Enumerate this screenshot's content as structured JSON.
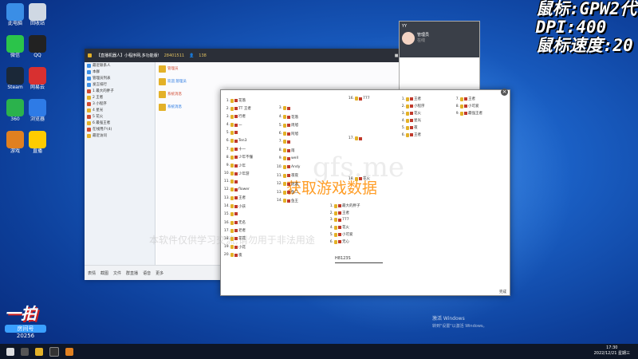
{
  "overlay": {
    "line1": "鼠标:GPW2代",
    "line2": "DPI:400",
    "line3": "鼠标速度:20"
  },
  "desktop_icons": [
    {
      "label": "此电脑",
      "color": "#3a8ee6"
    },
    {
      "label": "回收站",
      "color": "#cfd8e3"
    },
    {
      "label": "微信",
      "color": "#2bc44a"
    },
    {
      "label": "QQ",
      "color": "#222"
    },
    {
      "label": "Steam",
      "color": "#1b2838"
    },
    {
      "label": "网易云",
      "color": "#d83030"
    },
    {
      "label": "360",
      "color": "#2bb24c"
    },
    {
      "label": "浏览器",
      "color": "#2e7be6"
    },
    {
      "label": "游戏",
      "color": "#e08020"
    },
    {
      "label": "直播",
      "color": "#ffcc00"
    }
  ],
  "chat": {
    "title": "【直播机器人】小程序网,多功能版!",
    "id_text": "28401511",
    "count": "138",
    "side_rows": [
      "最近联系人",
      "本群",
      "管理员列表",
      "发言排行",
      "1 最大的胖子",
      "2 王者",
      "3 小程序",
      "4 星光",
      "5 花火",
      "6 最强王者",
      "在线用户(4)",
      "最近访问"
    ],
    "msgs": [
      "管理员",
      "欢迎,管理员",
      "系统消息",
      "系统消息"
    ],
    "foot": [
      "表情",
      "截图",
      "文件",
      "群直播",
      "语音",
      "更多"
    ]
  },
  "popup": {
    "title": "YY",
    "name": "管理员",
    "sub": "在线"
  },
  "tool": {
    "left_list": [
      {
        "n": "1.",
        "t": "花落"
      },
      {
        "n": "2.",
        "t": "TT 王者"
      },
      {
        "n": "3.",
        "t": "行者"
      },
      {
        "n": "4.",
        "t": "一"
      },
      {
        "n": "5.",
        "t": ""
      },
      {
        "n": "6.",
        "t": "Ten3"
      },
      {
        "n": "7.",
        "t": "十一"
      },
      {
        "n": "8.",
        "t": "少年不懂"
      },
      {
        "n": "9.",
        "t": "少年"
      },
      {
        "n": "10.",
        "t": "少年游"
      },
      {
        "n": "11.",
        "t": ""
      },
      {
        "n": "12.",
        "t": "flower"
      },
      {
        "n": "13.",
        "t": "王者"
      },
      {
        "n": "14.",
        "t": "小孩"
      },
      {
        "n": "15.",
        "t": ""
      },
      {
        "n": "16.",
        "t": "无名"
      },
      {
        "n": "17.",
        "t": "老者"
      },
      {
        "n": "18.",
        "t": "花花"
      },
      {
        "n": "19.",
        "t": "小花"
      },
      {
        "n": "20.",
        "t": "夜"
      }
    ],
    "mid_list": [
      {
        "n": "3.",
        "t": ""
      },
      {
        "n": "4.",
        "t": "花落"
      },
      {
        "n": "5.",
        "t": "周旭"
      },
      {
        "n": "6.",
        "t": "阿旭"
      },
      {
        "n": "7.",
        "t": ""
      },
      {
        "n": "8.",
        "t": "雨"
      },
      {
        "n": "9.",
        "t": "well"
      },
      {
        "n": "10.",
        "t": "Andy"
      },
      {
        "n": "11.",
        "t": "夜夜"
      },
      {
        "n": "12.",
        "t": "逍遥"
      },
      {
        "n": "13.",
        "t": "鱼二"
      },
      {
        "n": "14.",
        "t": "鱼王"
      }
    ],
    "center_list": [
      {
        "n": "1.",
        "t": "最大的胖子"
      },
      {
        "n": "2.",
        "t": "王者"
      },
      {
        "n": "3.",
        "t": "777"
      },
      {
        "n": "4.",
        "t": "花火"
      },
      {
        "n": "5.",
        "t": "小可爱"
      },
      {
        "n": "6.",
        "t": "无心"
      }
    ],
    "right_top": [
      {
        "n": "16.",
        "t": "777"
      },
      {
        "n": "17.",
        "t": ""
      },
      {
        "n": "18.",
        "t": "花火"
      }
    ],
    "right_col": [
      {
        "n": "1.",
        "t": "王者"
      },
      {
        "n": "2.",
        "t": "小程序"
      },
      {
        "n": "3.",
        "t": "花火"
      },
      {
        "n": "4.",
        "t": "星光"
      },
      {
        "n": "5.",
        "t": "夜"
      },
      {
        "n": "6.",
        "t": "王者"
      }
    ],
    "far_right": [
      {
        "n": "7.",
        "t": "王者"
      },
      {
        "n": "8.",
        "t": "小可爱"
      },
      {
        "n": "9.",
        "t": "最强王者"
      }
    ],
    "watermark_cn": "获取游戏数据",
    "watermark_en": "gfs.me",
    "watermark_tip": "本软件仅供学习交流,请勿用于非法用途",
    "input_value": "H8123S",
    "status": "完成"
  },
  "activate": {
    "line1": "激活 Windows",
    "line2": "转到\"设置\"以激活 Windows。"
  },
  "logo": {
    "big": "一拍",
    "pill": "房间号",
    "num": "20256"
  },
  "clock": {
    "time": "17:30",
    "date": "2022/12/21 星期三"
  }
}
